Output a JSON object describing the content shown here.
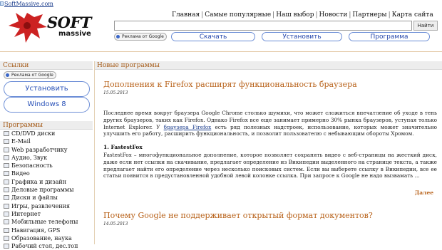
{
  "site": {
    "url_text": "SoftMassive.com",
    "logo_top": "SOFT",
    "logo_bottom": "massive"
  },
  "topnav": [
    "Главная",
    "Самые популярные",
    "Наш выбор",
    "Новости",
    "Партнеры",
    "Карта сайта"
  ],
  "search": {
    "value": "",
    "button": "Найти"
  },
  "ad_label": "Реклама от Google",
  "header_pills": [
    "Скачать",
    "Установить",
    "Программа"
  ],
  "sidebar": {
    "links_title": "Ссылки",
    "ad_label": "Реклама от Google",
    "buttons": [
      "Установить",
      "Windows 8"
    ],
    "programs_title": "Программы",
    "categories": [
      "CD/DVD диски",
      "E-Mail",
      "Web разработчику",
      "Аудио, Звук",
      "Безопасность",
      "Видео",
      "Графика и дизайн",
      "Деловые программы",
      "Диски и файлы",
      "Игры, развлечения",
      "Интернет",
      "Мобильные телефоны",
      "Навигация, GPS",
      "Образование, наука",
      "Рабочий стол, дес.топ"
    ]
  },
  "main": {
    "section_title": "Новые программы",
    "articles": [
      {
        "title": "Дополнения к Firefox расширят функциональность браузера",
        "date": "15.05.2013",
        "p1_before": "Последнее время вокруг браузера Google Chrome столько шумихи, что может сложиться впечатление об уходе в тень других браузеров, таких как Firefox. Однако Firefox все еще занимает примерно 30% рынка браузеров, уступая только Internet Explorer. У ",
        "p1_link": "браузера Firefox",
        "p1_after": " есть ряд полезных надстроек, использование, которых может значительно улучшить его работу, расширить функциональность, и позволит пользователю с небывающим обороты Хромом.",
        "sub": "1. FastestFox",
        "p2": "FastestFox – многофункциональное дополнение, которое позволяет сохранять видео с веб-страницы на жесткий диск, даже если нет ссылки на скачивание, предлагает определение из Википедии выделенного на странице текста, а также предлагает найти его определение через несколько поисковых систем. Если вы выберете ссылку в Википедии, все ее статьи появится в предустановленной удобной левой колонке ссылка. При запросе к Google не надо вызвамать …",
        "more": "Далее"
      },
      {
        "title": "Почему Google не поддерживает открытый формат документов?",
        "date": "14.05.2013"
      }
    ]
  }
}
